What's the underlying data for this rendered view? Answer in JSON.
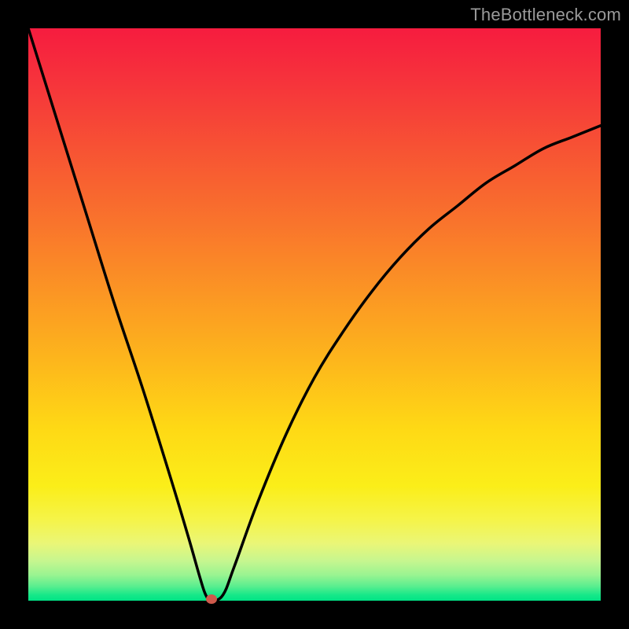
{
  "watermark": "TheBottleneck.com",
  "colors": {
    "frame": "#000000",
    "curve": "#000000",
    "marker": "#cf5a4c",
    "gradient_top": "#f61c3f",
    "gradient_bottom": "#00e385"
  },
  "chart_data": {
    "type": "line",
    "title": "",
    "xlabel": "",
    "ylabel": "",
    "xlim": [
      0,
      100
    ],
    "ylim": [
      0,
      100
    ],
    "grid": false,
    "legend": false,
    "annotations": [],
    "series": [
      {
        "name": "bottleneck-curve",
        "x": [
          0,
          5,
          10,
          15,
          20,
          25,
          28,
          30,
          31,
          32,
          34,
          36,
          40,
          45,
          50,
          55,
          60,
          65,
          70,
          75,
          80,
          85,
          90,
          95,
          100
        ],
        "values": [
          100,
          84,
          68,
          52,
          37,
          21,
          11,
          4,
          1,
          0,
          1,
          6,
          17,
          29,
          39,
          47,
          54,
          60,
          65,
          69,
          73,
          76,
          79,
          81,
          83
        ]
      }
    ],
    "marker": {
      "x": 32,
      "y": 0
    }
  }
}
